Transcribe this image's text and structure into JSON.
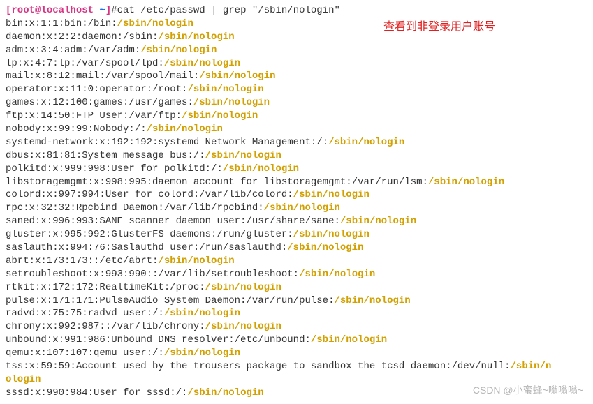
{
  "prompt": {
    "left_bracket": "[",
    "user_host": "root@localhost ",
    "tilde": "~",
    "right_bracket": "]",
    "hash": "#",
    "command": "cat /etc/passwd | grep \"/sbin/nologin\""
  },
  "nologin_token": "/sbin/nologin",
  "lines": [
    {
      "pre": "bin:x:1:1:bin:/bin:"
    },
    {
      "pre": "daemon:x:2:2:daemon:/sbin:"
    },
    {
      "pre": "adm:x:3:4:adm:/var/adm:"
    },
    {
      "pre": "lp:x:4:7:lp:/var/spool/lpd:"
    },
    {
      "pre": "mail:x:8:12:mail:/var/spool/mail:"
    },
    {
      "pre": "operator:x:11:0:operator:/root:"
    },
    {
      "pre": "games:x:12:100:games:/usr/games:"
    },
    {
      "pre": "ftp:x:14:50:FTP User:/var/ftp:"
    },
    {
      "pre": "nobody:x:99:99:Nobody:/:"
    },
    {
      "pre": "systemd-network:x:192:192:systemd Network Management:/:"
    },
    {
      "pre": "dbus:x:81:81:System message bus:/:"
    },
    {
      "pre": "polkitd:x:999:998:User for polkitd:/:"
    },
    {
      "pre": "libstoragemgmt:x:998:995:daemon account for libstoragemgmt:/var/run/lsm:"
    },
    {
      "pre": "colord:x:997:994:User for colord:/var/lib/colord:"
    },
    {
      "pre": "rpc:x:32:32:Rpcbind Daemon:/var/lib/rpcbind:"
    },
    {
      "pre": "saned:x:996:993:SANE scanner daemon user:/usr/share/sane:"
    },
    {
      "pre": "gluster:x:995:992:GlusterFS daemons:/run/gluster:"
    },
    {
      "pre": "saslauth:x:994:76:Saslauthd user:/run/saslauthd:"
    },
    {
      "pre": "abrt:x:173:173::/etc/abrt:"
    },
    {
      "pre": "setroubleshoot:x:993:990::/var/lib/setroubleshoot:"
    },
    {
      "pre": "rtkit:x:172:172:RealtimeKit:/proc:"
    },
    {
      "pre": "pulse:x:171:171:PulseAudio System Daemon:/var/run/pulse:"
    },
    {
      "pre": "radvd:x:75:75:radvd user:/:"
    },
    {
      "pre": "chrony:x:992:987::/var/lib/chrony:"
    },
    {
      "pre": "unbound:x:991:986:Unbound DNS resolver:/etc/unbound:"
    },
    {
      "pre": "qemu:x:107:107:qemu user:/:"
    },
    {
      "pre": "tss:x:59:59:Account used by the trousers package to sandbox the tcsd daemon:/dev/null:",
      "wrap_split": [
        "/sbin/n",
        "ologin"
      ]
    },
    {
      "pre": "sssd:x:990:984:User for sssd:/:"
    }
  ],
  "annotation": "查看到非登录用户账号",
  "watermark": "CSDN @小蜜蜂~嗡嗡嗡~"
}
